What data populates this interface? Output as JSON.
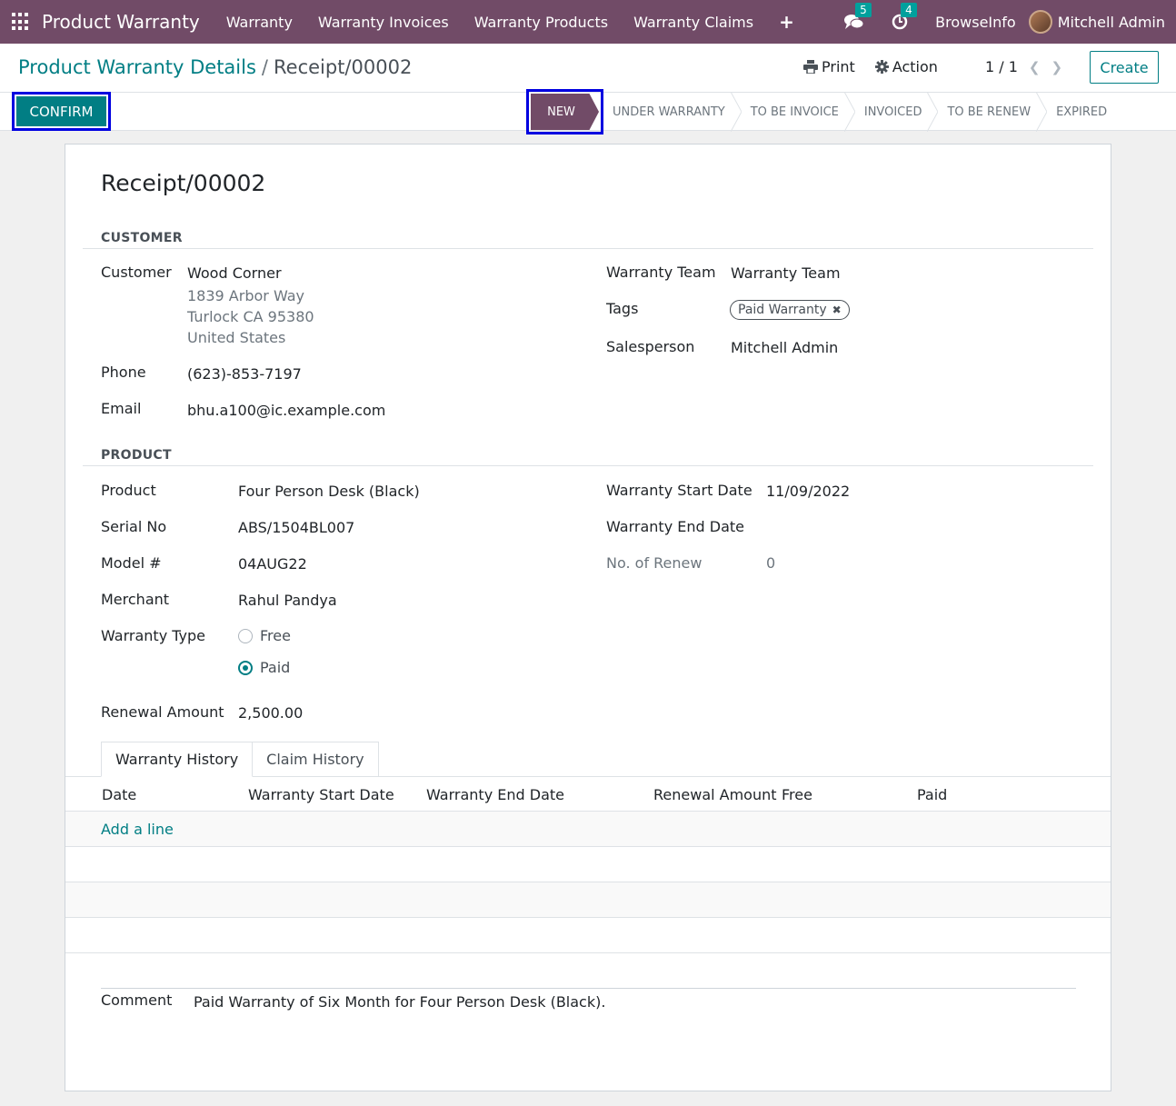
{
  "nav": {
    "brand": "Product Warranty",
    "items": [
      "Warranty",
      "Warranty Invoices",
      "Warranty Products",
      "Warranty Claims"
    ],
    "messages_count": "5",
    "activities_count": "4",
    "company": "BrowseInfo",
    "user": "Mitchell Admin"
  },
  "control": {
    "breadcrumb_parent": "Product Warranty Details",
    "breadcrumb_sep": "/",
    "breadcrumb_current": "Receipt/00002",
    "print_label": "Print",
    "action_label": "Action",
    "pager": "1 / 1",
    "create_label": "Create",
    "confirm_label": "CONFIRM"
  },
  "stages": {
    "current": "NEW",
    "others": [
      "UNDER WARRANTY",
      "TO BE INVOICE",
      "INVOICED",
      "TO BE RENEW",
      "EXPIRED"
    ]
  },
  "record": {
    "title": "Receipt/00002",
    "customer_section": "CUSTOMER",
    "customer_label": "Customer",
    "customer_name": "Wood Corner",
    "address_line1": "1839 Arbor Way",
    "address_line2": "Turlock CA 95380",
    "address_line3": "United States",
    "phone_label": "Phone",
    "phone": "(623)-853-7197",
    "email_label": "Email",
    "email": "bhu.a100@ic.example.com",
    "team_label": "Warranty Team",
    "team": "Warranty Team",
    "tags_label": "Tags",
    "tag": "Paid Warranty",
    "salesperson_label": "Salesperson",
    "salesperson": "Mitchell Admin",
    "product_section": "PRODUCT",
    "product_label": "Product",
    "product": "Four Person Desk (Black)",
    "serial_label": "Serial No",
    "serial": "ABS/1504BL007",
    "model_label": "Model #",
    "model": "04AUG22",
    "merchant_label": "Merchant",
    "merchant": "Rahul Pandya",
    "warranty_type_label": "Warranty Type",
    "type_free": "Free",
    "type_paid": "Paid",
    "renewal_label": "Renewal Amount",
    "renewal": "2,500.00",
    "start_label": "Warranty Start Date",
    "start": "11/09/2022",
    "end_label": "Warranty End Date",
    "renew_count_label": "No. of Renew",
    "renew_count": "0"
  },
  "tabs": [
    "Warranty History",
    "Claim History"
  ],
  "table": {
    "columns": [
      "Date",
      "Warranty Start Date",
      "Warranty End Date",
      "Renewal Amount",
      "Free",
      "Paid"
    ],
    "add_line": "Add a line"
  },
  "comment": {
    "label": "Comment",
    "text": "Paid Warranty of Six Month for Four Person Desk (Black)."
  }
}
